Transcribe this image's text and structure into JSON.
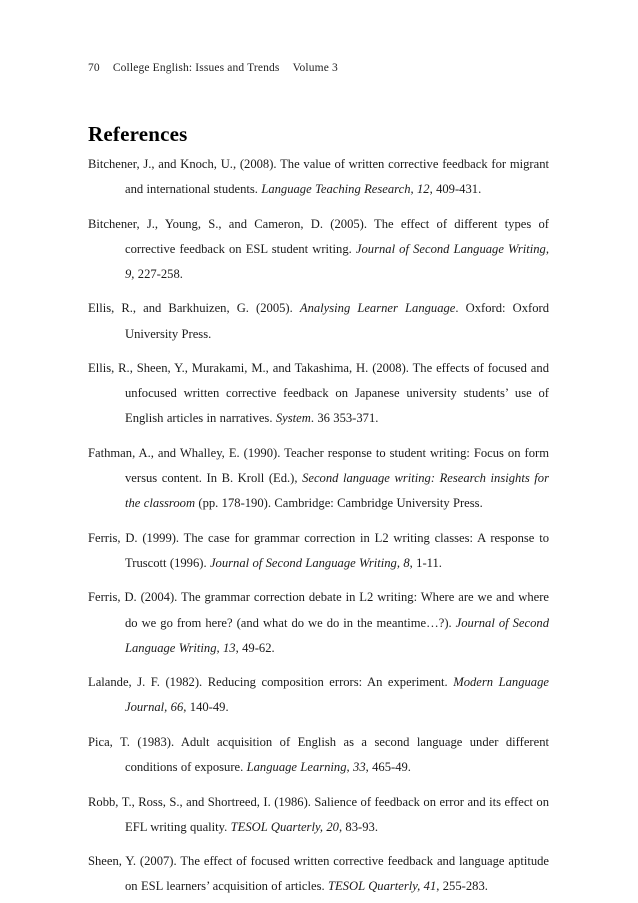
{
  "page": {
    "running_head": {
      "folio": "70",
      "publication": "College English: Issues and Trends",
      "volume": "Volume 3"
    },
    "section_title": "References"
  },
  "references": [
    {
      "id": "bitchener-knoch-2008",
      "parts": [
        {
          "text": "Bitchener, J., and Knoch, U., (2008). The value of written corrective feedback for migrant and international students. ",
          "style": "roman"
        },
        {
          "text": "Language Teaching Research, 12",
          "style": "italic"
        },
        {
          "text": ", 409-431.",
          "style": "roman"
        }
      ]
    },
    {
      "id": "bitchener-young-cameron-2005",
      "parts": [
        {
          "text": "Bitchener, J., Young, S., and Cameron, D. (2005). The effect of different types of corrective feedback on ESL student writing. ",
          "style": "roman"
        },
        {
          "text": "Journal of Second Language Writing, 9",
          "style": "italic"
        },
        {
          "text": ", 227-258.",
          "style": "roman"
        }
      ]
    },
    {
      "id": "ellis-barkhuizen-2005",
      "parts": [
        {
          "text": "Ellis, R., and Barkhuizen, G. (2005). ",
          "style": "roman"
        },
        {
          "text": "Analysing Learner Language",
          "style": "italic"
        },
        {
          "text": ". Oxford: Oxford University Press.",
          "style": "roman"
        }
      ]
    },
    {
      "id": "ellis-sheen-murakami-takashima-2008",
      "parts": [
        {
          "text": "Ellis, R., Sheen, Y., Murakami, M., and Takashima, H. (2008). The effects of focused and unfocused written corrective feedback on Japanese university students’ use of English articles in narratives. ",
          "style": "roman"
        },
        {
          "text": "System",
          "style": "italic"
        },
        {
          "text": ". 36 353-371.",
          "style": "roman"
        }
      ]
    },
    {
      "id": "fathman-whalley-1990",
      "parts": [
        {
          "text": "Fathman, A., and Whalley, E. (1990). Teacher response to student writing: Focus on form versus content. In B. Kroll (Ed.), ",
          "style": "roman"
        },
        {
          "text": "Second language writing: Research insights for the classroom",
          "style": "italic"
        },
        {
          "text": " (pp. 178-190). Cambridge: Cambridge University Press.",
          "style": "roman"
        }
      ]
    },
    {
      "id": "ferris-1999",
      "parts": [
        {
          "text": "Ferris, D. (1999). The case for grammar correction in L2 writing classes: A response to Truscott (1996). ",
          "style": "roman"
        },
        {
          "text": "Journal of Second Language Writing, 8",
          "style": "italic"
        },
        {
          "text": ", 1-11.",
          "style": "roman"
        }
      ]
    },
    {
      "id": "ferris-2004",
      "parts": [
        {
          "text": "Ferris, D. (2004). The grammar correction debate in L2 writing: Where are we and where do we go from here? (and what do we do in the meantime…?). ",
          "style": "roman"
        },
        {
          "text": "Journal of Second Language Writing, 13",
          "style": "italic"
        },
        {
          "text": ", 49-62.",
          "style": "roman"
        }
      ]
    },
    {
      "id": "lalande-1982",
      "parts": [
        {
          "text": "Lalande, J. F. (1982). Reducing composition errors: An experiment. ",
          "style": "roman"
        },
        {
          "text": "Modern Language Journal, 66",
          "style": "italic"
        },
        {
          "text": ", 140-49.",
          "style": "roman"
        }
      ]
    },
    {
      "id": "pica-1983",
      "parts": [
        {
          "text": "Pica, T. (1983). Adult acquisition of English as a second language under different conditions of exposure. ",
          "style": "roman"
        },
        {
          "text": "Language Learning, 33",
          "style": "italic"
        },
        {
          "text": ", 465-49.",
          "style": "roman"
        }
      ]
    },
    {
      "id": "robb-ross-shortreed-1986",
      "parts": [
        {
          "text": "Robb, T., Ross, S., and Shortreed, I. (1986). Salience of feedback on error and its effect on EFL writing quality. ",
          "style": "roman"
        },
        {
          "text": "TESOL Quarterly, 20",
          "style": "italic"
        },
        {
          "text": ", 83-93.",
          "style": "roman"
        }
      ]
    },
    {
      "id": "sheen-2007",
      "parts": [
        {
          "text": "Sheen, Y. (2007). The effect of focused written corrective feedback and language aptitude on ESL learners’ acquisition of articles. ",
          "style": "roman"
        },
        {
          "text": "TESOL Quarterly, 41",
          "style": "italic"
        },
        {
          "text": ", 255-283.",
          "style": "roman"
        }
      ]
    }
  ]
}
